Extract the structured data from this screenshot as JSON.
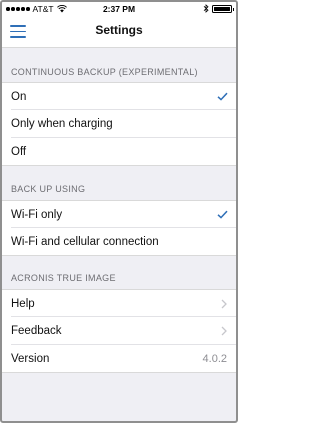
{
  "status_bar": {
    "carrier": "AT&T",
    "time": "2:37 PM"
  },
  "nav": {
    "title": "Settings",
    "menu_icon": "hamburger-menu-icon"
  },
  "sections": {
    "continuous_backup": {
      "header": "CONTINUOUS BACKUP (EXPERIMENTAL)",
      "options": [
        "On",
        "Only when charging",
        "Off"
      ],
      "selected": "On"
    },
    "back_up_using": {
      "header": "BACK UP USING",
      "options": [
        "Wi-Fi only",
        "Wi-Fi and cellular connection"
      ],
      "selected": "Wi-Fi only"
    },
    "acronis": {
      "header": "ACRONIS TRUE IMAGE",
      "help": "Help",
      "feedback": "Feedback",
      "version_label": "Version",
      "version_value": "4.0.2"
    }
  },
  "colors": {
    "accent": "#2f6fb7",
    "background": "#efeff4",
    "header_text": "#6d6d72",
    "secondary_text": "#8e8e93"
  }
}
